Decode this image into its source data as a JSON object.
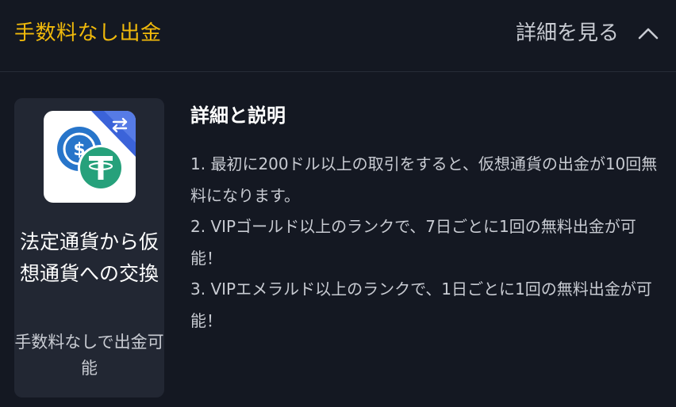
{
  "header": {
    "title": "手数料なし出金",
    "toggle_label": "詳細を見る",
    "toggle_icon": "chevron-up-icon"
  },
  "card": {
    "image_icons": [
      "usdc-icon",
      "tether-icon",
      "swap-icon"
    ],
    "title": "法定通貨から仮想通貨への交換",
    "subtitle": "手数料なしで出金可能"
  },
  "details": {
    "heading": "詳細と説明",
    "items": [
      "1. 最初に200ドル以上の取引をすると、仮想通貨の出金が10回無料になります。",
      "2. VIPゴールド以上のランクで、7日ごとに1回の無料出金が可能！",
      "3. VIPエメラルド以上のランクで、1日ごとに1回の無料出金が可能！"
    ]
  },
  "colors": {
    "background": "#141822",
    "accent": "#f0b90b",
    "card_background": "#222733",
    "usdc_blue": "#2775ca",
    "tether_green": "#26a17b",
    "swap_blue": "#3b63d9"
  }
}
